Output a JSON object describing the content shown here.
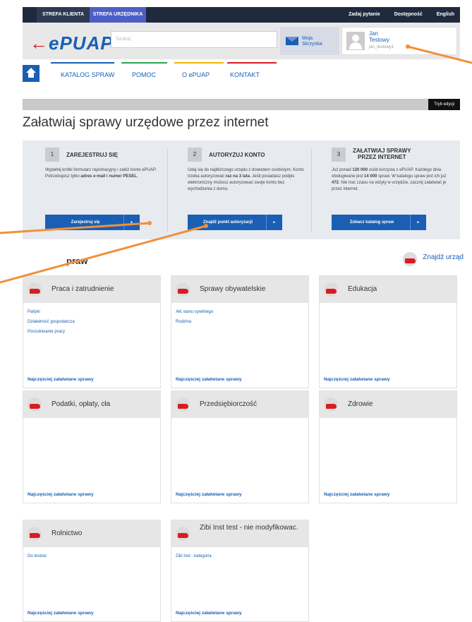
{
  "topbar": {
    "tab_client": "STREFA KLIENTA",
    "tab_official": "STREFA URZĘDNIKA",
    "ask": "Zadaj pytanie",
    "access": "Dostępność",
    "lang": "English"
  },
  "header": {
    "logo_arrow": "←",
    "logo_text": "ePUAP",
    "search_placeholder": "Szukaj",
    "inbox_line1": "Moja",
    "inbox_line2": "Skrzynka",
    "user_first": "Jan",
    "user_last": "Testowy",
    "user_login": "jan_testowy1"
  },
  "nav": {
    "items": [
      "KATALOG SPRAW",
      "POMOC",
      "O ePUAP",
      "KONTAKT"
    ],
    "stripe_colors": [
      "#1a5fb4",
      "#2ea44f",
      "#f4b400",
      "#d81c23"
    ]
  },
  "edit_mode": "Tryb edycji",
  "page_title": "Załatwiaj sprawy urzędowe przez internet",
  "steps": [
    {
      "num": "1",
      "title": "ZAREJESTRUJ SIĘ",
      "desc_a": "Wypełnij krótki formularz rejestracyjny i załóż konto ePUAP. Potrzebujesz tylko ",
      "desc_b": "adres e-mail i numer PESEL",
      "desc_c": ".",
      "button": "Zarejestruj się"
    },
    {
      "num": "2",
      "title": "AUTORYZUJ KONTO",
      "desc_a": "Udaj się do najbliższego urzędu z dowodem osobistym. Konto trzeba autoryzować ",
      "desc_b": "raz na 3 lata",
      "desc_c": ". Jeśli posiadasz podpis elektroniczny możesz autoryzować swoje konto bez wychodzenia z domu.",
      "button": "Znajdź punkt autoryzacji"
    },
    {
      "num": "3",
      "title_1": "ZAŁATWIAJ SPRAWY",
      "title_2": "PRZEZ INTERNET",
      "d1": "Już ponad ",
      "d2": "120 000",
      "d3": " osób korzysta z ePUAP. Każdego dnia obsługiwane jest ",
      "d4": "14 000",
      "d5": " spraw. W katalogu spraw jest ich już ",
      "d6": "472",
      "d7": ". Nie trać czasu na wizyty w urzędzie, zacznij załatwiać je przez internet.",
      "button": "Zobacz katalog spraw"
    }
  ],
  "section_title": "praw",
  "find_office": "Znajdź urząd",
  "cards": [
    {
      "title": "Praca i zatrudnienie",
      "links": [
        "Paltyki",
        "Działalność gospodarcza",
        "Poszukiwanie pracy"
      ],
      "footer": "Najczęściej załatwiane sprawy"
    },
    {
      "title": "Sprawy obywatelskie",
      "links": [
        "Akt stanu cywilnego",
        "Rodzina"
      ],
      "footer": "Najczęściej załatwiane sprawy"
    },
    {
      "title": "Edukacja",
      "links": [],
      "footer": "Najczęściej załatwiane sprawy"
    },
    {
      "title": "Podatki, opłaty, cła",
      "links": [],
      "footer": "Najczęściej załatwiane sprawy"
    },
    {
      "title": "Przedsiębiorczość",
      "links": [],
      "footer": "Najczęściej załatwiane sprawy"
    },
    {
      "title": "Zdrowie",
      "links": [],
      "footer": "Najczęściej załatwiane sprawy"
    },
    {
      "title": "Rolnictwo",
      "links": [
        "Do testow"
      ],
      "footer": "Najczęściej załatwiane sprawy"
    },
    {
      "title": "Zibi Inst test - nie modyfikowac.",
      "links": [
        "Zibi inst - kategoria"
      ],
      "footer": "Najczęściej załatwiane sprawy"
    }
  ],
  "annotation_color": "#f0913a"
}
